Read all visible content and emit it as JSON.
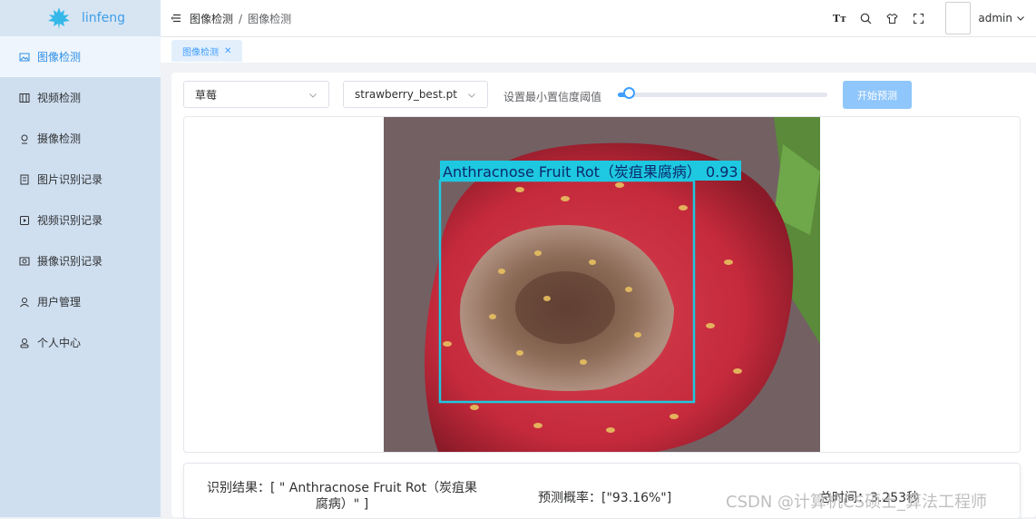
{
  "app": {
    "logo_text": "linfeng",
    "brand_color": "#409eff"
  },
  "sidebar": {
    "items": [
      {
        "label": "图像检测",
        "icon": "image-icon",
        "active": true
      },
      {
        "label": "视频检测",
        "icon": "video-icon"
      },
      {
        "label": "摄像检测",
        "icon": "camera-icon"
      },
      {
        "label": "图片识别记录",
        "icon": "document-icon"
      },
      {
        "label": "视频识别记录",
        "icon": "video-record-icon"
      },
      {
        "label": "摄像识别记录",
        "icon": "camera-record-icon"
      },
      {
        "label": "用户管理",
        "icon": "users-icon"
      },
      {
        "label": "个人中心",
        "icon": "user-icon"
      }
    ]
  },
  "header": {
    "breadcrumb": [
      "图像检测",
      "图像检测"
    ],
    "tool_font_label": "Tт",
    "tools": [
      "font-size-icon",
      "search-icon",
      "theme-icon",
      "fullscreen-icon"
    ],
    "user_name": "admin"
  },
  "tags": [
    {
      "label": "图像检测",
      "close": "✕"
    }
  ],
  "controls": {
    "fruit_select": "草莓",
    "model_select": "strawberry_best.pt",
    "threshold_label": "设置最小置信度阈值",
    "threshold_value": 0.05,
    "predict_button": "开始预测"
  },
  "detection": {
    "box_label": "Anthracnose Fruit Rot（炭疽果腐病） 0.93",
    "box_color": "#1ec8e0"
  },
  "results": {
    "label_line1": "识别结果：[ \" Anthracnose Fruit Rot（炭疽果",
    "label_line2": "腐病）\" ]",
    "probability": "预测概率：[\"93.16%\"]",
    "time": "总时间：3.253秒"
  },
  "watermark": "CSDN @计算机CS硕士_算法工程师"
}
